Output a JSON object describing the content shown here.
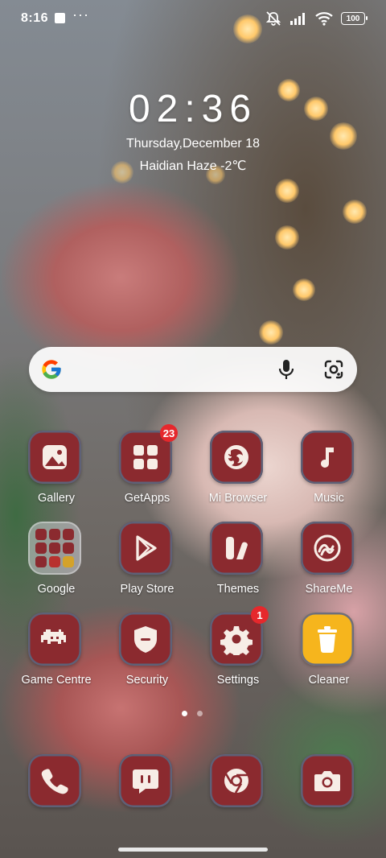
{
  "status_bar": {
    "time": "8:16",
    "overflow": "···",
    "battery": "100"
  },
  "clock": {
    "time": "02:36",
    "date": "Thursday,December 18",
    "weather": "Haidian Haze -2℃"
  },
  "search_bar": {
    "logo": "google-g-icon"
  },
  "apps": [
    {
      "label": "Gallery",
      "icon": "gallery-icon"
    },
    {
      "label": "GetApps",
      "icon": "getapps-icon",
      "badge": "23"
    },
    {
      "label": "Mi Browser",
      "icon": "browser-icon"
    },
    {
      "label": "Music",
      "icon": "music-icon"
    },
    {
      "label": "Google",
      "icon": "google-folder-icon"
    },
    {
      "label": "Play Store",
      "icon": "play-store-icon"
    },
    {
      "label": "Themes",
      "icon": "themes-icon"
    },
    {
      "label": "ShareMe",
      "icon": "shareme-icon"
    },
    {
      "label": "Game Centre",
      "icon": "game-centre-icon"
    },
    {
      "label": "Security",
      "icon": "security-icon"
    },
    {
      "label": "Settings",
      "icon": "settings-icon",
      "badge": "1"
    },
    {
      "label": "Cleaner",
      "icon": "cleaner-icon"
    }
  ],
  "dock": [
    {
      "icon": "phone-icon"
    },
    {
      "icon": "messages-icon"
    },
    {
      "icon": "chrome-icon"
    },
    {
      "icon": "camera-icon"
    }
  ],
  "pager": {
    "pages": 2,
    "active": 1
  },
  "colors": {
    "tile": "#8b2a2f",
    "tile_border": "#5e6177",
    "badge": "#e6282c",
    "cleaner": "#f6b51d",
    "icon_fg": "#f7ede6"
  }
}
